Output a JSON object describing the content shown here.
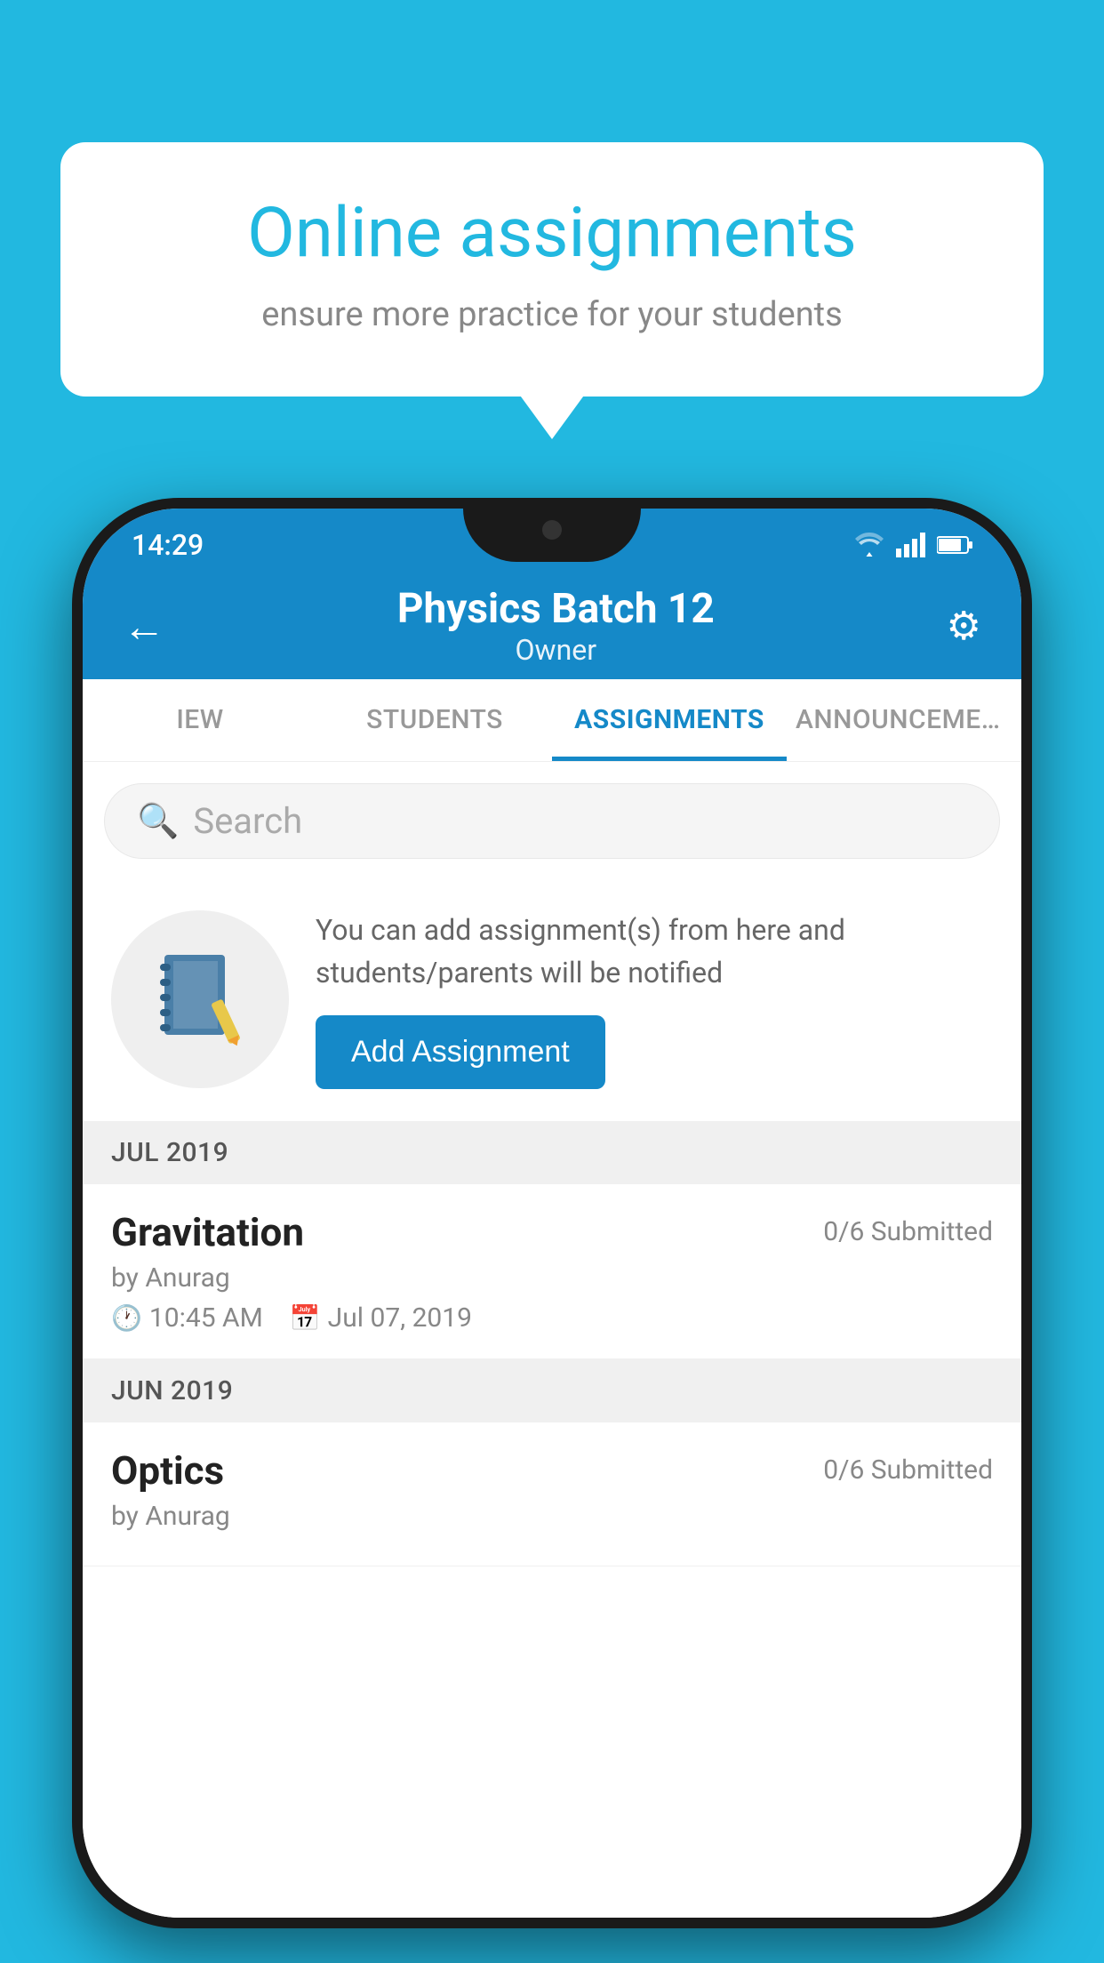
{
  "background_color": "#22b8e0",
  "speech_bubble": {
    "title": "Online assignments",
    "subtitle": "ensure more practice for your students"
  },
  "phone": {
    "status_bar": {
      "time": "14:29",
      "wifi_icon": "wifi",
      "signal_icon": "signal",
      "battery_icon": "battery"
    },
    "top_nav": {
      "back_icon": "←",
      "title": "Physics Batch 12",
      "subtitle": "Owner",
      "settings_icon": "⚙"
    },
    "tabs": [
      {
        "label": "IEW",
        "active": false
      },
      {
        "label": "STUDENTS",
        "active": false
      },
      {
        "label": "ASSIGNMENTS",
        "active": true
      },
      {
        "label": "ANNOUNCEMENTS",
        "active": false
      }
    ],
    "search": {
      "placeholder": "Search",
      "icon": "🔍"
    },
    "add_assignment_section": {
      "prompt_text": "You can add assignment(s) from here and students/parents will be notified",
      "button_label": "Add Assignment"
    },
    "sections": [
      {
        "month": "JUL 2019",
        "assignments": [
          {
            "name": "Gravitation",
            "submitted": "0/6 Submitted",
            "author": "by Anurag",
            "time": "10:45 AM",
            "date": "Jul 07, 2019"
          }
        ]
      },
      {
        "month": "JUN 2019",
        "assignments": [
          {
            "name": "Optics",
            "submitted": "0/6 Submitted",
            "author": "by Anurag",
            "time": "",
            "date": ""
          }
        ]
      }
    ]
  }
}
